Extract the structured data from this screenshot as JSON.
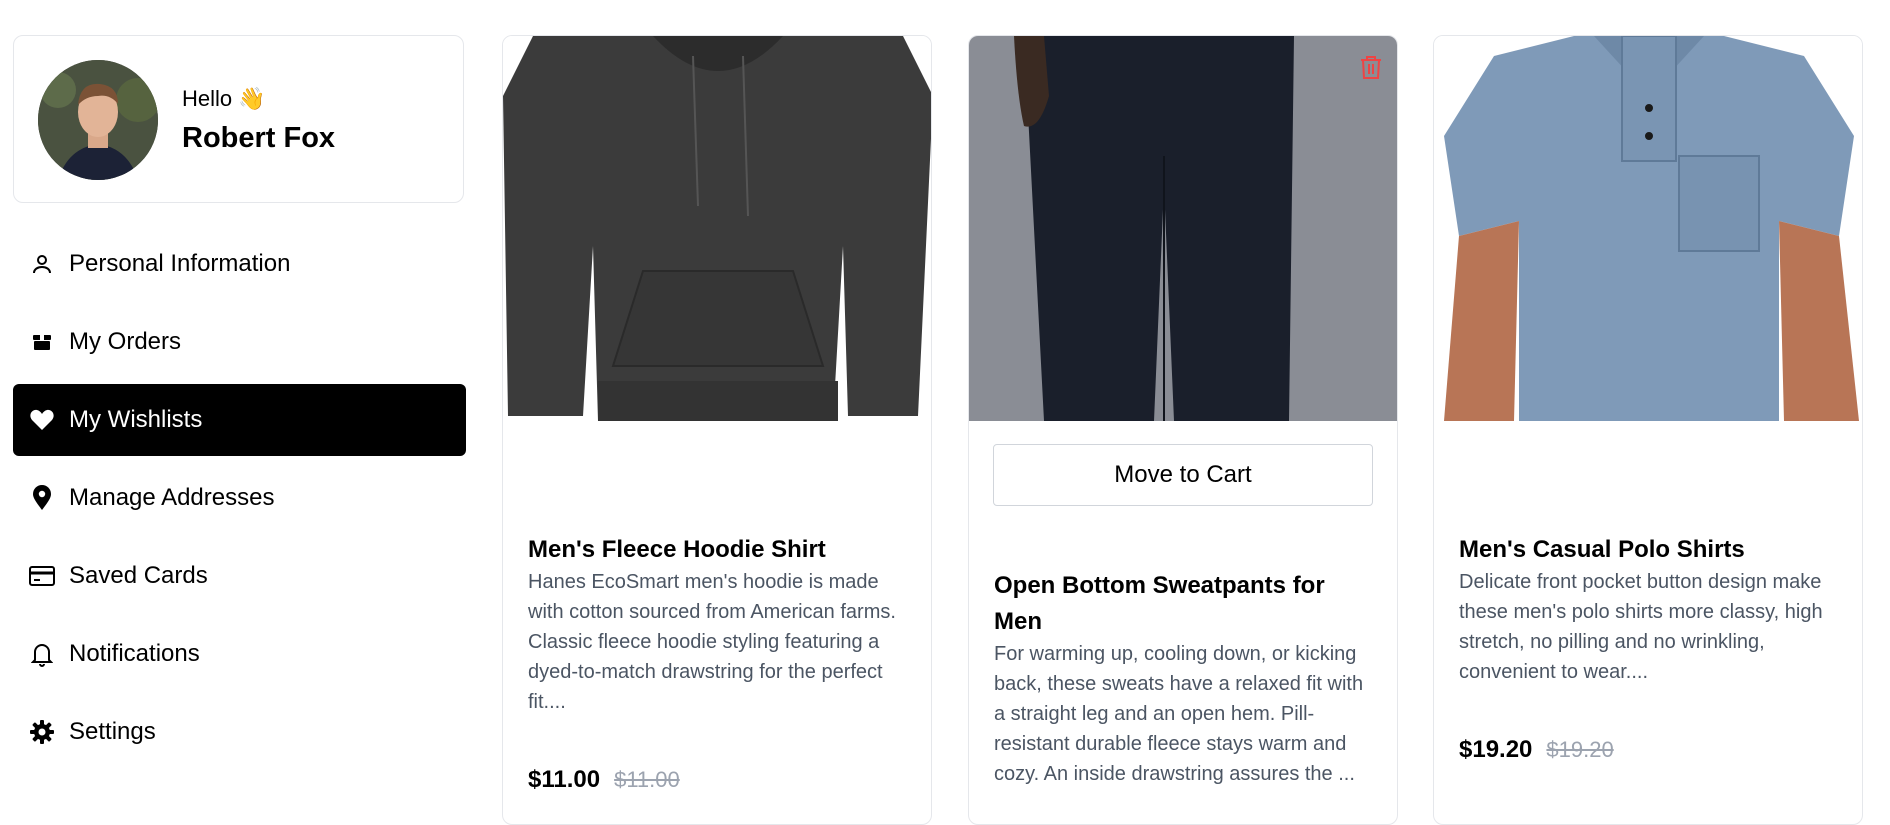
{
  "profile": {
    "greeting": "Hello",
    "wave": "👋",
    "name": "Robert Fox"
  },
  "nav": {
    "items": [
      {
        "label": "Personal Information",
        "icon": "user-icon"
      },
      {
        "label": "My Orders",
        "icon": "box-icon"
      },
      {
        "label": "My Wishlists",
        "icon": "heart-icon",
        "active": true
      },
      {
        "label": "Manage Addresses",
        "icon": "map-pin-icon"
      },
      {
        "label": "Saved Cards",
        "icon": "credit-card-icon"
      },
      {
        "label": "Notifications",
        "icon": "bell-icon"
      },
      {
        "label": "Settings",
        "icon": "gear-icon"
      }
    ]
  },
  "products": [
    {
      "title": "Men's Fleece Hoodie Shirt",
      "description": "Hanes EcoSmart men's hoodie is made with cotton sourced from American farms. Classic fleece hoodie styling featuring a dyed-to-match drawstring for the perfect fit....",
      "price": "$11.00",
      "old_price": "$11.00"
    },
    {
      "title": "Open Bottom Sweatpants for Men",
      "description": "For warming up, cooling down, or kicking back, these sweats have a relaxed fit with a straight leg and an open hem. Pill-resistant durable fleece stays warm and cozy. An inside drawstring assures the ...",
      "move_to_cart": "Move to Cart"
    },
    {
      "title": "Men's Casual Polo Shirts",
      "description": "Delicate front pocket button design make these men's polo shirts more classy, high stretch, no pilling and no wrinkling, convenient to wear....",
      "price": "$19.20",
      "old_price": "$19.20"
    }
  ],
  "colors": {
    "active_nav_bg": "#000000",
    "trash_icon": "#ef4444",
    "description_text": "#4b5563"
  }
}
